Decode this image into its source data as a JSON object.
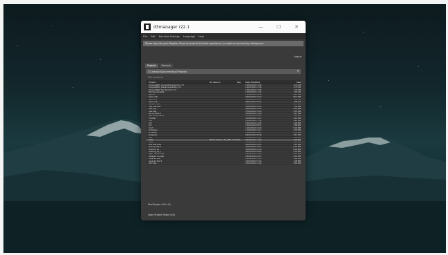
{
  "window": {
    "title": "d3manager  r22.1"
  },
  "window_controls": {
    "minimize": "—",
    "maximize": "☐",
    "close": "✕"
  },
  "menu": [
    "File",
    "Edit",
    "Machine Settings",
    "Language",
    "Help"
  ],
  "banner": "Please sign into your Magister Cloud account for the best experience, or create an account by clicking here",
  "login": "Log in",
  "tabs": [
    "Projects",
    "Network"
  ],
  "path": "C:\\Users\\d3\\Documents\\d3 Projects",
  "filter": "Filter projects",
  "columns": {
    "project": "Project",
    "version": "d3 Version",
    "tag": "Tag",
    "modified": "Date Modified",
    "size": "Size"
  },
  "rows": [
    {
      "name": "DisguiseBRD_ContentManagement_r17",
      "version": "",
      "modified": "16/05/2022 13:40",
      "size": "4.21 GB"
    },
    {
      "name": "DisguiseBRD_StageVisualisation_r17",
      "version": "",
      "modified": "16/05/2022 13:39",
      "size": "2.70 GB"
    },
    {
      "name": "DisguiseBRD_TouchControl_r17",
      "version": "",
      "modified": "16/05/2022 13:39",
      "size": "1.18 GB"
    },
    {
      "name": "Pharma_Showflat",
      "version": "",
      "modified": "12/05/2022 11:02",
      "size": "3.01 GB"
    },
    {
      "name": "api_r17",
      "version": "",
      "modified": "11/05/2022 16:42",
      "size": "2.21 MB"
    },
    {
      "name": "demo r18",
      "version": "",
      "modified": "09/05/2022 10:24",
      "size": "84.0 MB"
    },
    {
      "name": "demo r19",
      "version": "",
      "modified": "09/05/2022 10:24",
      "size": "5.02 GB"
    },
    {
      "name": "demo r20",
      "version": "",
      "modified": "06/05/2022 09:10",
      "size": "4.89 GB"
    },
    {
      "name": "network test",
      "version": "",
      "modified": "05/05/2022 14:55",
      "size": "12.5 MB"
    },
    {
      "name": "new new test",
      "version": "",
      "modified": "03/05/2022 16:10",
      "size": "7.33 MB"
    },
    {
      "name": "new proj",
      "version": "",
      "modified": "28/04/2022 10:33",
      "size": "6.02 MB"
    },
    {
      "name": "new test",
      "version": "",
      "modified": "27/04/2022 15:18",
      "size": "5.91 MB"
    },
    {
      "name": "pb rig office 2",
      "version": "",
      "modified": "26/04/2022 12:20",
      "size": "9.13 MB"
    },
    {
      "name": "pwc shows demo",
      "version": "",
      "modified": "25/04/2022 09:40",
      "size": "210 MB"
    },
    {
      "name": "r18 test",
      "version": "",
      "modified": "22/04/2022 11:11",
      "size": "4.10 MB"
    },
    {
      "name": "r19",
      "version": "",
      "modified": "21/04/2022 17:02",
      "size": "4.22 MB"
    },
    {
      "name": "r20",
      "version": "",
      "modified": "20/04/2022 14:30",
      "size": "4.09 MB"
    },
    {
      "name": "rb1",
      "version": "",
      "modified": "19/04/2022 08:57",
      "size": "3.88 MB"
    },
    {
      "name": "rbcrt",
      "version": "",
      "modified": "14/04/2022 16:44",
      "size": "5.04 MB"
    },
    {
      "name": "scheduler",
      "version": "",
      "modified": "13/04/2022 12:13",
      "size": "3.76 MB"
    },
    {
      "name": "showtest",
      "version": "",
      "modified": "12/04/2022 10:21",
      "size": "4.55 MB"
    },
    {
      "name": "stageproj",
      "version": "",
      "modified": "08/04/2022 09:48",
      "size": "5.67 MB"
    },
    {
      "name": "test",
      "version": "",
      "modified": "07/04/2022 15:05",
      "size": "3.30 MB"
    },
    {
      "name": "test1",
      "version": "Newer Engine, r19_ORD, Contents",
      "modified": "06/04/2022 13:50",
      "size": "2.98 MB",
      "selected": true
    },
    {
      "name": "test2",
      "version": "",
      "modified": "05/04/2022 11:26",
      "size": "3.12 MB"
    },
    {
      "name": "test distribute",
      "version": "",
      "modified": "04/04/2022 10:01",
      "size": "3.41 MB"
    },
    {
      "name": "training r18.0",
      "version": "",
      "modified": "01/04/2022 16:15",
      "size": "6.20 MB"
    },
    {
      "name": "Training_18",
      "version": "",
      "modified": "31/03/2022 12:34",
      "size": "6.02 MB"
    },
    {
      "name": "Training_19_1",
      "version": "",
      "modified": "30/03/2022 09:20",
      "size": "5.76 MB"
    },
    {
      "name": "tiger model show",
      "version": "",
      "modified": "29/03/2022 14:40",
      "size": "8.11 MB"
    },
    {
      "name": "unsaved concept",
      "version": "",
      "modified": "28/03/2022 10:57",
      "size": "2.01 MB"
    },
    {
      "name": "unsaved test",
      "version": "",
      "modified": "25/03/2022 17:23",
      "size": "1.96 MB"
    },
    {
      "name": "unsaved test 2",
      "version": "",
      "modified": "24/03/2022 15:02",
      "size": "1.98 MB"
    },
    {
      "name": "vfhc test",
      "version": "",
      "modified": "23/03/2022 11:44",
      "size": "2.44 MB"
    }
  ],
  "footer": {
    "new_project": "Find Project (Ctrl+O)",
    "open_folder": "Open Project Folder (Alt)"
  }
}
